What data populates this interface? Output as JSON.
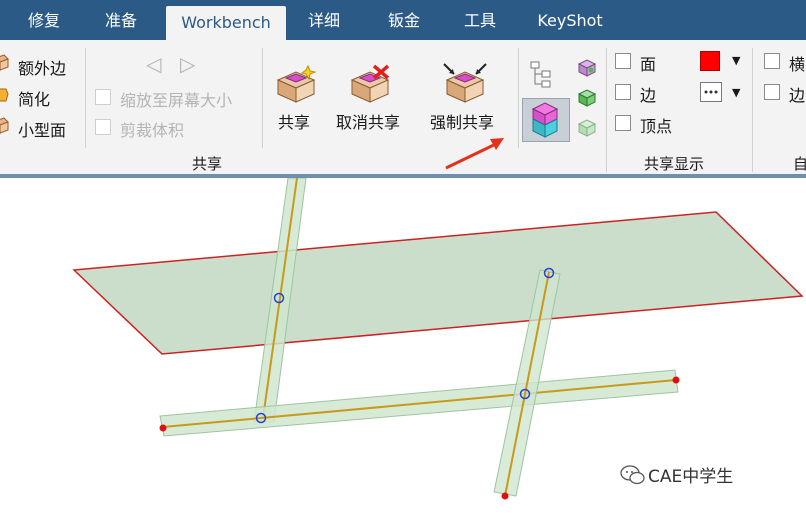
{
  "tabs": [
    {
      "label": "修复"
    },
    {
      "label": "准备"
    },
    {
      "label": "Workbench",
      "active": true
    },
    {
      "label": "详细"
    },
    {
      "label": "钣金"
    },
    {
      "label": "工具"
    },
    {
      "label": "KeyShot"
    }
  ],
  "left_group": {
    "items": [
      "额外边",
      "简化",
      "小型面"
    ]
  },
  "share_group": {
    "nav_prev": "◁",
    "nav_next": "▷",
    "option_zoom": "缩放至屏幕大小",
    "option_crop": "剪裁体积",
    "share_button": "共享",
    "unshare_button": "取消共享",
    "force_share_button": "强制共享",
    "group_label": "共享"
  },
  "display_group": {
    "face_label": "面",
    "edge_label": "边",
    "vertex_label": "顶点",
    "face_color": "#ff0000",
    "group_label": "共享显示"
  },
  "right_group": {
    "item1": "横",
    "item2": "边",
    "group_label_partial": "自"
  },
  "watermark": {
    "text": "CAE中学生"
  },
  "colors": {
    "tabbar": "#2c5a86",
    "plane_fill": "#b5cfb5",
    "plane_edge": "#cc2222",
    "beam_fill": "#cfe6cf",
    "beam_line": "#c79a1a",
    "node_blue": "#2a3fd0",
    "node_red": "#e01010",
    "arrow_red": "#e3311b"
  }
}
